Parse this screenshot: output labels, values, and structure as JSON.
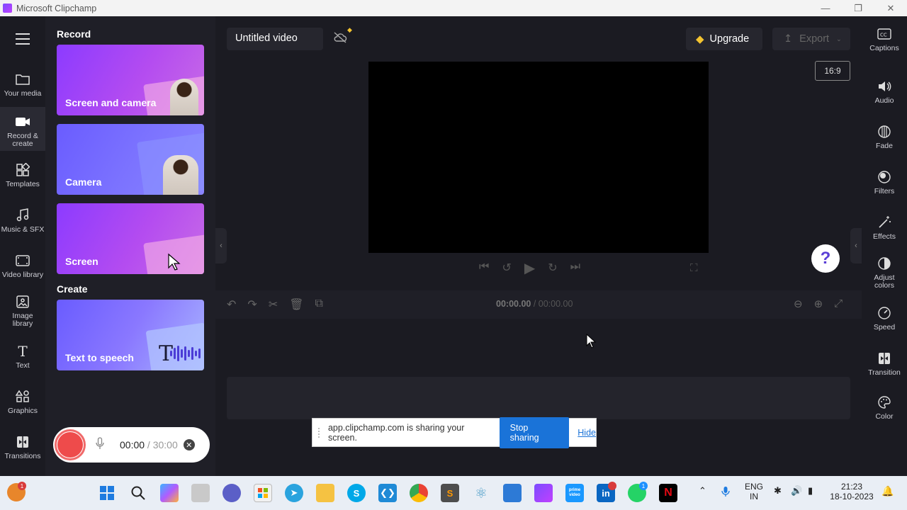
{
  "window": {
    "title": "Microsoft Clipchamp",
    "controls": [
      "minimize",
      "restore",
      "close"
    ]
  },
  "leftnav": {
    "items": [
      {
        "label": "Your media",
        "icon": "folder-icon"
      },
      {
        "label": "Record & create",
        "icon": "camera-icon"
      },
      {
        "label": "Templates",
        "icon": "templates-icon"
      },
      {
        "label": "Music & SFX",
        "icon": "music-icon"
      },
      {
        "label": "Video library",
        "icon": "film-icon"
      },
      {
        "label": "Image library",
        "icon": "image-icon"
      },
      {
        "label": "Text",
        "icon": "text-icon"
      },
      {
        "label": "Graphics",
        "icon": "graphics-icon"
      },
      {
        "label": "Transitions",
        "icon": "transitions-icon"
      }
    ],
    "active": "Record & create"
  },
  "panel": {
    "record_title": "Record",
    "create_title": "Create",
    "cards": {
      "screen_and_camera": "Screen and camera",
      "camera": "Camera",
      "screen": "Screen",
      "text_to_speech": "Text to speech"
    }
  },
  "recorder": {
    "elapsed": "00:00",
    "separator": " / ",
    "total": "30:00"
  },
  "editor": {
    "video_title": "Untitled video",
    "upgrade_label": "Upgrade",
    "export_label": "Export",
    "aspect_ratio": "16:9",
    "help_label": "?",
    "timecode_current": "00:00.00",
    "timecode_separator": " / ",
    "timecode_total": "00:00.00"
  },
  "share_banner": {
    "message": "app.clipchamp.com is sharing your screen.",
    "stop_label": "Stop sharing",
    "hide_label": "Hide"
  },
  "rightrail": {
    "items": [
      {
        "label": "Captions",
        "icon": "captions-icon"
      },
      {
        "label": "Audio",
        "icon": "audio-icon"
      },
      {
        "label": "Fade",
        "icon": "fade-icon"
      },
      {
        "label": "Filters",
        "icon": "filters-icon"
      },
      {
        "label": "Effects",
        "icon": "effects-icon"
      },
      {
        "label": "Adjust colors",
        "icon": "adjust-colors-icon"
      },
      {
        "label": "Speed",
        "icon": "speed-icon"
      },
      {
        "label": "Transition",
        "icon": "transition-icon"
      },
      {
        "label": "Color",
        "icon": "palette-icon"
      }
    ]
  },
  "taskbar": {
    "language": "ENG",
    "region": "IN",
    "time": "21:23",
    "date": "18-10-2023",
    "badges": {
      "notification": "1",
      "whatsapp": "1"
    },
    "apps": [
      "Start",
      "Search",
      "Copilot",
      "File Explorer",
      "Teams",
      "Microsoft Store",
      "Telegram",
      "Files",
      "Skype",
      "VS Code",
      "Chrome",
      "Sublime Text",
      "React Native",
      "Notepad",
      "Clipchamp",
      "Prime Video",
      "LinkedIn",
      "WhatsApp",
      "Netflix"
    ],
    "prime_label": "prime video",
    "linkedin_label": "in",
    "netflix_label": "N",
    "skype_label": "S"
  },
  "colors": {
    "accent_purple": "#8c3bff",
    "record_red": "#ee4b4b",
    "stop_blue": "#1a73d8",
    "gem_gold": "#f4c430",
    "app_bg": "#1b1b22"
  }
}
